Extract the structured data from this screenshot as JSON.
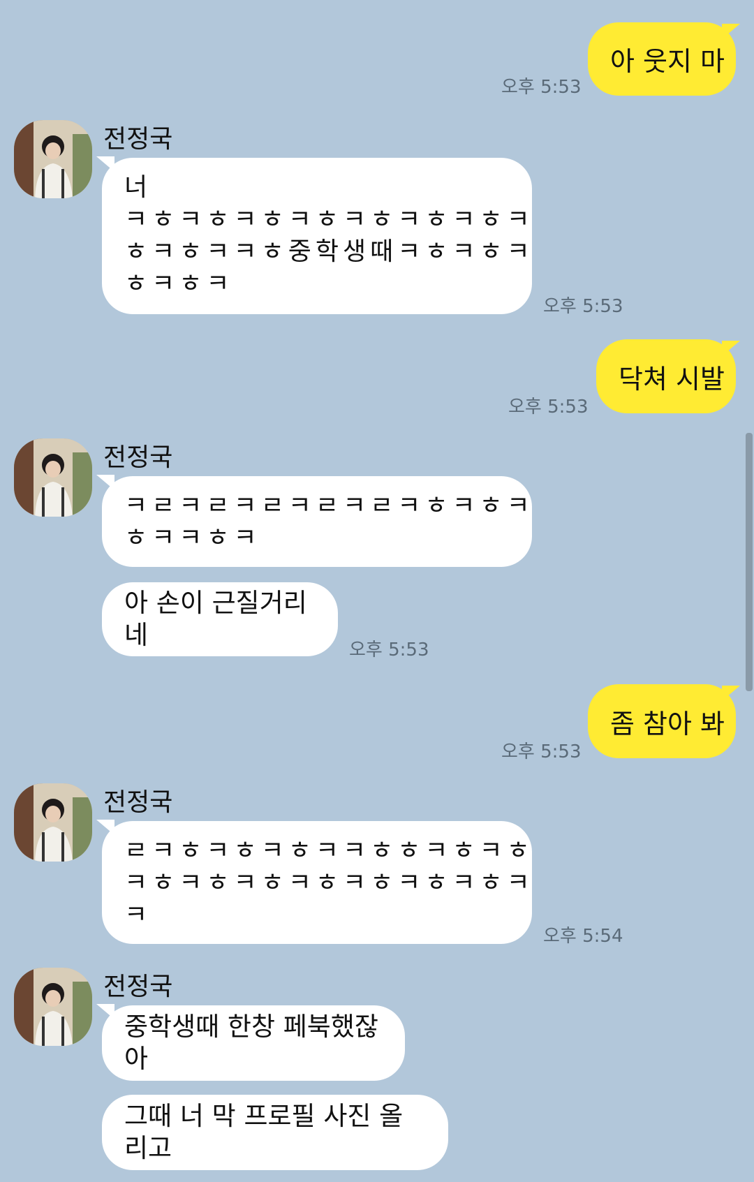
{
  "contact": {
    "name": "전정국"
  },
  "messages": [
    {
      "id": "m1",
      "dir": "out",
      "text": "아 웃지 마",
      "time": "오후 5:53"
    },
    {
      "id": "m2",
      "dir": "in",
      "lines": [
        "너",
        "ㅋㅎㅋㅎㅋㅎㅋㅎㅋㅎㅋㅎㅋㅎㅋ",
        "ㅎㅋㅎㅋㅋㅎ중학생때ㅋㅎㅋㅎㅋ",
        "ㅎㅋㅎㅋ"
      ],
      "time": "오후 5:53"
    },
    {
      "id": "m3",
      "dir": "out",
      "text": "닥쳐 시발",
      "time": "오후 5:53"
    },
    {
      "id": "m4",
      "dir": "in",
      "lines": [
        "ㅋㄹㅋㄹㅋㄹㅋㄹㅋㄹㅋㅎㅋㅎㅋ",
        "ㅎㅋㅋㅎㅋ"
      ]
    },
    {
      "id": "m5",
      "dir": "in",
      "text": "아 손이 근질거리네",
      "time": "오후 5:53"
    },
    {
      "id": "m6",
      "dir": "out",
      "text": "좀 참아 봐",
      "time": "오후 5:53"
    },
    {
      "id": "m7",
      "dir": "in",
      "lines": [
        "ㄹㅋㅎㅋㅎㅋㅎㅋㅋㅎㅎㅋㅎㅋㅎ",
        "ㅋㅎㅋㅎㅋㅎㅋㅎㅋㅎㅋㅎㅋㅎㅋ",
        "ㅋ"
      ],
      "time": "오후 5:54"
    },
    {
      "id": "m8",
      "dir": "in",
      "text": "중학생때 한창 페북했잖아"
    },
    {
      "id": "m9",
      "dir": "in",
      "text": "그때 너 막 프로필 사진 올리고"
    }
  ]
}
